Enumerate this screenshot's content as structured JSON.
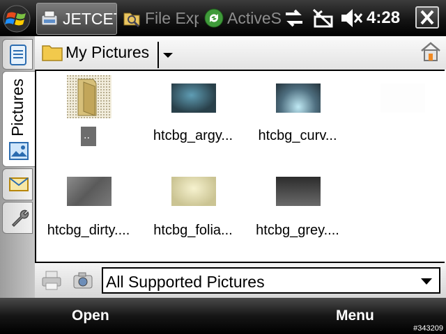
{
  "taskbar": {
    "tasks": [
      {
        "label": "JETCET",
        "icon": "jetcet-app-icon",
        "active": true
      },
      {
        "label": "File Exp",
        "icon": "file-explorer-icon",
        "active": false
      },
      {
        "label": "ActiveS",
        "icon": "activesync-icon",
        "active": false
      }
    ],
    "status_icons": [
      "connectivity-icon",
      "signal-off-icon",
      "volume-muted-icon"
    ],
    "time": "4:28",
    "close_icon": "close-icon"
  },
  "sidebar": {
    "tabs": [
      {
        "name": "documents",
        "icon": "document-icon"
      },
      {
        "name": "pictures",
        "label": "Pictures",
        "icon": "picture-icon",
        "selected": true
      },
      {
        "name": "messages",
        "icon": "envelope-icon"
      },
      {
        "name": "settings",
        "icon": "wrench-icon"
      }
    ]
  },
  "header": {
    "folder": "My Pictures",
    "home_icon": "home-icon"
  },
  "files": [
    {
      "name": "..",
      "kind": "parent-folder"
    },
    {
      "name": "htcbg_argy...",
      "kind": "image"
    },
    {
      "name": "htcbg_curv...",
      "kind": "image"
    },
    {
      "name": "",
      "kind": "image-blank"
    },
    {
      "name": "htcbg_dirty....",
      "kind": "image"
    },
    {
      "name": "htcbg_folia...",
      "kind": "image"
    },
    {
      "name": "htcbg_grey....",
      "kind": "image"
    }
  ],
  "filter": {
    "value": "All Supported Pictures",
    "printer_icon": "printer-icon",
    "camera_icon": "camera-icon"
  },
  "softkeys": {
    "left": "Open",
    "right": "Menu"
  },
  "watermark": "#343209"
}
